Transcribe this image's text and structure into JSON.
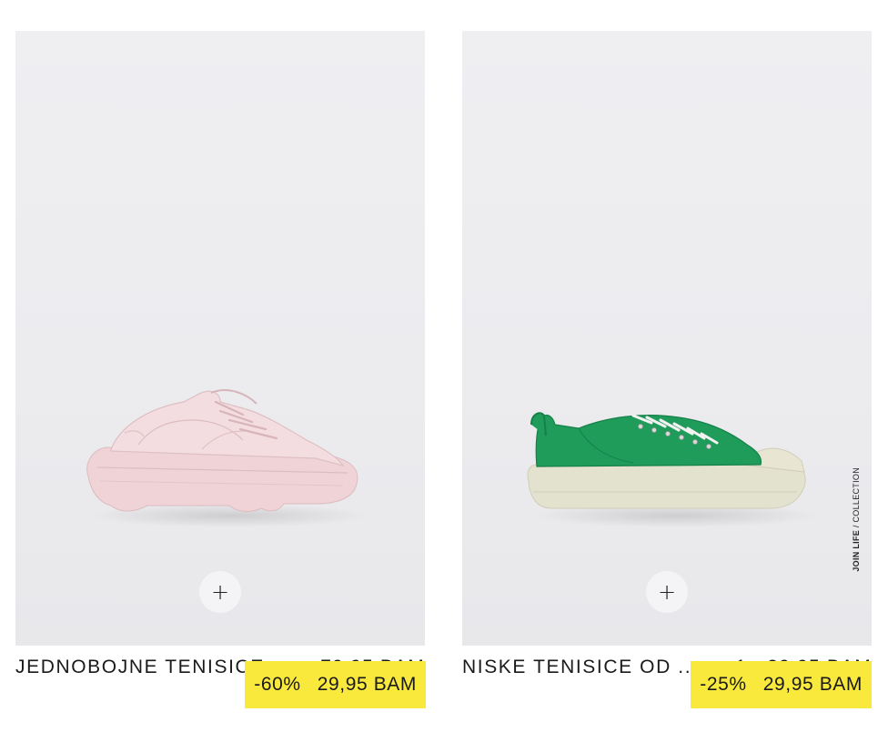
{
  "products": [
    {
      "name": "JEDNOBOJNE TENISICE",
      "original_price": "79,95 BAM",
      "discount": "-60%",
      "sale_price": "29,95 BAM",
      "add_button": "+",
      "image_color": "#f0d9dc"
    },
    {
      "name": "NISKE TENISICE OD ...",
      "original_price": "39,95 BAM",
      "discount": "-25%",
      "sale_price": "29,95 BAM",
      "add_button": "+",
      "more_colors": "+1",
      "swatch_color": "#0c9a5a",
      "image_color": "#1f9b5a",
      "badge_bold": "JOIN LIFE",
      "badge_rest": " / COLLECTION"
    }
  ],
  "colors": {
    "sale_highlight": "#f9e93d",
    "background": "#ececef",
    "text": "#1a1a1a"
  }
}
